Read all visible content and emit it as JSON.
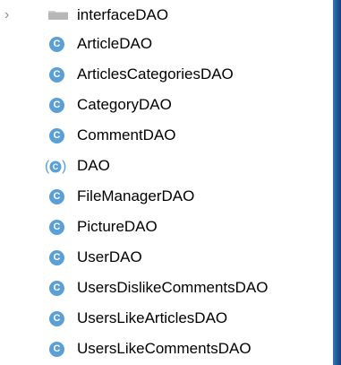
{
  "tree": {
    "items": [
      {
        "label": "interfaceDAO",
        "icon": "folder-icon",
        "expandable": true
      },
      {
        "label": "ArticleDAO",
        "icon": "class-icon"
      },
      {
        "label": "ArticlesCategoriesDAO",
        "icon": "class-icon"
      },
      {
        "label": "CategoryDAO",
        "icon": "class-icon"
      },
      {
        "label": "CommentDAO",
        "icon": "class-icon"
      },
      {
        "label": "DAO",
        "icon": "abstract-class-icon"
      },
      {
        "label": "FileManagerDAO",
        "icon": "class-icon"
      },
      {
        "label": "PictureDAO",
        "icon": "class-icon"
      },
      {
        "label": "UserDAO",
        "icon": "class-icon"
      },
      {
        "label": "UsersDislikeCommentsDAO",
        "icon": "class-icon"
      },
      {
        "label": "UsersLikeArticlesDAO",
        "icon": "class-icon"
      },
      {
        "label": "UsersLikeCommentsDAO",
        "icon": "class-icon"
      }
    ]
  },
  "icons": {
    "class_letter": "C",
    "chevron": "›"
  },
  "colors": {
    "class_icon": "#5a9fd5",
    "background": "#ffffff",
    "window_edge": "#1b4f93"
  }
}
